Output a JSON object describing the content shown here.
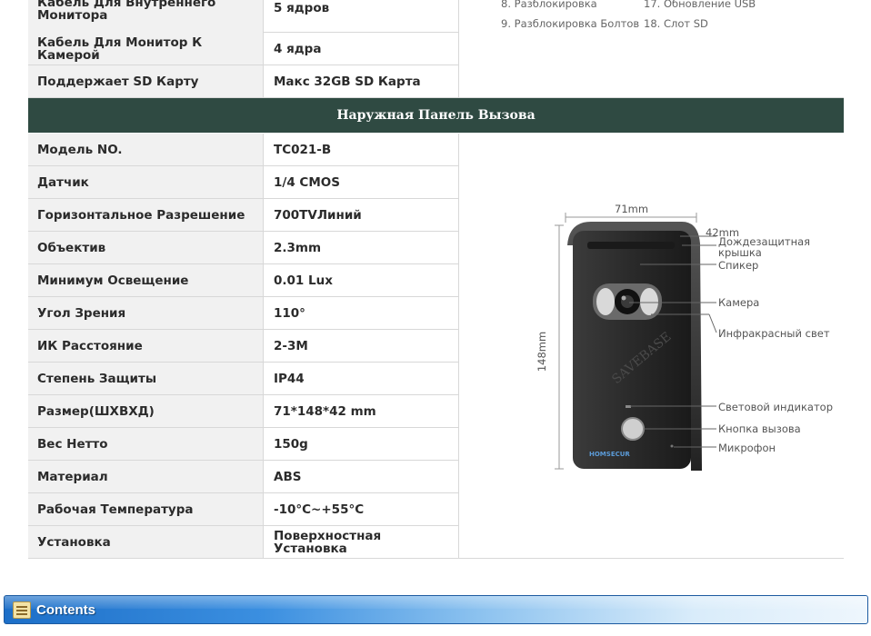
{
  "top_rows": [
    {
      "key": "Кабель Для Внутреннего Монитора",
      "value": "5 ядров"
    },
    {
      "key": "Кабель Для Монитор К Камерой",
      "value": "4 ядра"
    },
    {
      "key": "Поддержает SD Карту",
      "value": "Макс 32GB SD Карта"
    }
  ],
  "connectors": [
    "8. Разблокировка",
    "17. Обновление USB",
    "9. Разблокировка Болтов",
    "18. Слот SD"
  ],
  "section_title": "Наружная Панель Вызова",
  "spec_rows": [
    {
      "key": "Модель NO.",
      "value": "TC021-B"
    },
    {
      "key": "Датчик",
      "value": "1/4 CMOS"
    },
    {
      "key": "Горизонтальное Разрешение",
      "value": "700TVЛиний"
    },
    {
      "key": "Объектив",
      "value": "2.3mm"
    },
    {
      "key": "Минимум Освещение",
      "value": "0.01 Lux"
    },
    {
      "key": "Угол Зрения",
      "value": "110°"
    },
    {
      "key": "ИК Расстояние",
      "value": "2-3M"
    },
    {
      "key": "Степень Защиты",
      "value": "IP44"
    },
    {
      "key": "Размер(ШХВХД)",
      "value": "71*148*42 mm"
    },
    {
      "key": "Вес Нетто",
      "value": "150g"
    },
    {
      "key": "Материал",
      "value": "ABS"
    },
    {
      "key": "Рабочая Температура",
      "value": "-10°C~+55°C"
    },
    {
      "key": "Установка",
      "value": "Поверхностная Установка"
    }
  ],
  "figure": {
    "width_label": "71mm",
    "height_label": "148mm",
    "depth_label": "42mm",
    "brand_text": "SAVEBASE",
    "logo_text": "HOMSECUR",
    "callouts": [
      "Дождезащитная крышка",
      "Спикер",
      "Камера",
      "Инфракрасный свет",
      "Световой индикатор",
      "Кнопка вызова",
      "Микрофон"
    ]
  },
  "contents_bar": {
    "title": "Contents",
    "icon": "document-icon"
  },
  "colors": {
    "header_bg": "#2f4a42",
    "bar_blue": "#1d6fc8"
  }
}
